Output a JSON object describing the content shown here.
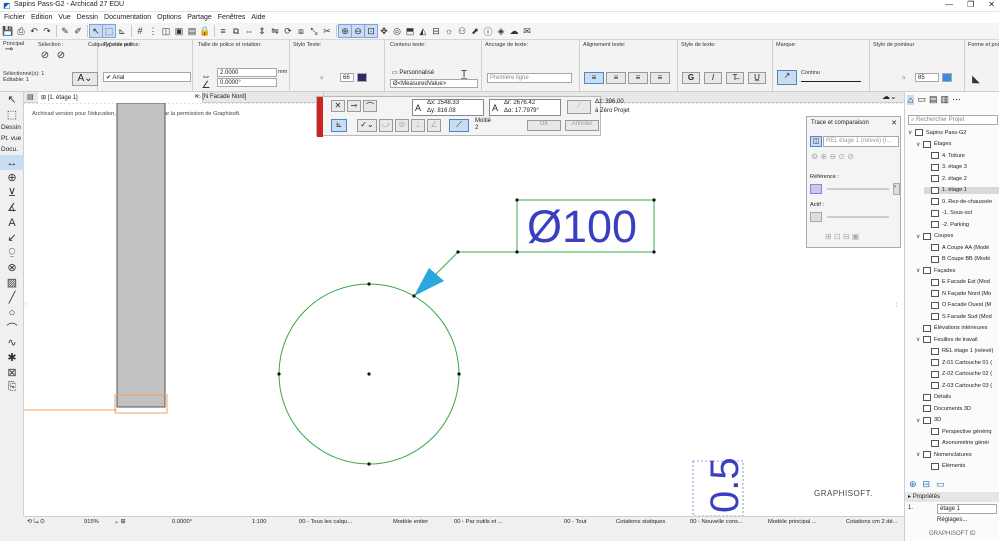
{
  "window": {
    "title": "Sapins Pass-G2 - Archicad 27 EDU",
    "controls": [
      "—",
      "❐",
      "✕"
    ]
  },
  "menu": [
    "Fichier",
    "Edition",
    "Vue",
    "Dessin",
    "Documentation",
    "Options",
    "Partage",
    "Fenêtres",
    "Aide"
  ],
  "infobox": {
    "principal_label": "Principal",
    "selection_label": "Sélection :",
    "layers_label": "Calque(s) des auti",
    "selected_count": "Sélectionné(s): 1",
    "editable_count": "Éditable: 1",
    "font_type_label": "Type de police:",
    "font_value": "Arial",
    "font_size_label": "Taille de police et rotation:",
    "font_size": "2.0000",
    "font_size_unit": "mm",
    "rotation": "0.0000°",
    "text_style_label": "Stylo Texte:",
    "pen_value": "66",
    "text_content_label": "Contenu texte:",
    "text_content_value": "Personnalisé",
    "measured_value": "Ø<MeasuredValue>",
    "anchor_label": "Ancrage de texte:",
    "anchor_value": "Première ligne",
    "align_label": "Alignement texte:",
    "style_label": "Style de texte:",
    "marker_label": "Marque:",
    "marker_value": "Continu",
    "pointer_pen_label": "Stylo de pointeur",
    "pointer_pen_value": "85",
    "form_label": "Forme et pointe"
  },
  "tabs": [
    {
      "label": "[1. étage 1]",
      "active": true
    },
    {
      "label": "[N Facade Nord]",
      "active": false
    }
  ],
  "watermark": "Archicad version pour l'éducation, revente interdite. Par la permission de Graphisoft.",
  "dim_panel": {
    "dx": "Δx: 2548.33",
    "dy": "Δy: 816.08",
    "dr": "Δr: 2676.42",
    "da": "Δα: 17.7979°",
    "dz": "Δz: 396.00",
    "ref": "à Zéro Projet",
    "mode": "Moitié",
    "mode_num": "2",
    "ok": "OK",
    "cancel": "Annuler"
  },
  "canvas": {
    "dimension_label": "Ø100",
    "partial_text": "0.5"
  },
  "trace": {
    "title": "Trace et comparaison",
    "source": "REL étage 1 (relevé) (I...",
    "reference": "Référence :",
    "active": "Actif :"
  },
  "navigator": {
    "search_placeholder": "Rechercher Projet",
    "items": [
      {
        "label": "Sapins Pass-G2",
        "level": 0,
        "toggle": "∨"
      },
      {
        "label": "Étages",
        "level": 1,
        "toggle": "∨"
      },
      {
        "label": "4. Toiture",
        "level": 2,
        "toggle": ""
      },
      {
        "label": "3. étage 3",
        "level": 2,
        "toggle": ""
      },
      {
        "label": "2. étage 2",
        "level": 2,
        "toggle": ""
      },
      {
        "label": "1. étage 1",
        "level": 2,
        "toggle": "",
        "selected": true
      },
      {
        "label": "0. Rez-de-chaussée",
        "level": 2,
        "toggle": ""
      },
      {
        "label": "-1. Sous-sol",
        "level": 2,
        "toggle": ""
      },
      {
        "label": "-2. Parking",
        "level": 2,
        "toggle": ""
      },
      {
        "label": "Coupes",
        "level": 1,
        "toggle": "∨"
      },
      {
        "label": "A Coupe AA (Modé",
        "level": 2,
        "toggle": ""
      },
      {
        "label": "B Coupe BB (Modé",
        "level": 2,
        "toggle": ""
      },
      {
        "label": "Façades",
        "level": 1,
        "toggle": "∨"
      },
      {
        "label": "E Facade Est (Mod",
        "level": 2,
        "toggle": ""
      },
      {
        "label": "N Façade Nord (Mo",
        "level": 2,
        "toggle": ""
      },
      {
        "label": "O Facade Ouest (M",
        "level": 2,
        "toggle": ""
      },
      {
        "label": "S Facade Sud (Mod",
        "level": 2,
        "toggle": ""
      },
      {
        "label": "Élévations intérieures",
        "level": 1,
        "toggle": ""
      },
      {
        "label": "Feuilles de travail",
        "level": 1,
        "toggle": "∨"
      },
      {
        "label": "REL étage 1 (relevé)",
        "level": 2,
        "toggle": ""
      },
      {
        "label": "Z-01 Cartouche 01 (",
        "level": 2,
        "toggle": ""
      },
      {
        "label": "Z-02 Cartouche 02 (",
        "level": 2,
        "toggle": ""
      },
      {
        "label": "Z-03 Cartouche 03 (",
        "level": 2,
        "toggle": ""
      },
      {
        "label": "Détails",
        "level": 1,
        "toggle": ""
      },
      {
        "label": "Documents 3D",
        "level": 1,
        "toggle": ""
      },
      {
        "label": "3D",
        "level": 1,
        "toggle": "∨"
      },
      {
        "label": "Perspective génériq",
        "level": 2,
        "toggle": ""
      },
      {
        "label": "Axonométrie génér",
        "level": 2,
        "toggle": ""
      },
      {
        "label": "Nomenclatures",
        "level": 1,
        "toggle": "∨"
      },
      {
        "label": "Éléments",
        "level": 2,
        "toggle": ""
      }
    ],
    "brand": "GRAPHISOFT.",
    "properties_label": "Propriétés",
    "prop_num": "1.",
    "prop_value": "étage 1",
    "settings": "Réglages...",
    "footer_brand": "GRAPHISOFT ID"
  },
  "toolbox": {
    "labels": [
      "Dessin",
      "Pt. vue",
      "Docu."
    ]
  },
  "statusbar": {
    "zoom": "915%",
    "angle": "0.0000°",
    "scale": "1:100",
    "layers": "00 - Tous les calqu...",
    "model": "Modèle entier",
    "pen_set": "00 - Par outils et ...",
    "all": "00 - Tout",
    "annotations": "Cotations statiques",
    "new_cons": "00 - Nouvelle cons...",
    "model_principal": "Modèle principal ...",
    "cotations": "Cotations cm 2 dé..."
  },
  "colors": {
    "circle": "#39a845",
    "leader": "#39a845",
    "arrow": "#2aa7dc",
    "dim_text": "#3a3fbf",
    "wall": "#c2c2c2"
  }
}
